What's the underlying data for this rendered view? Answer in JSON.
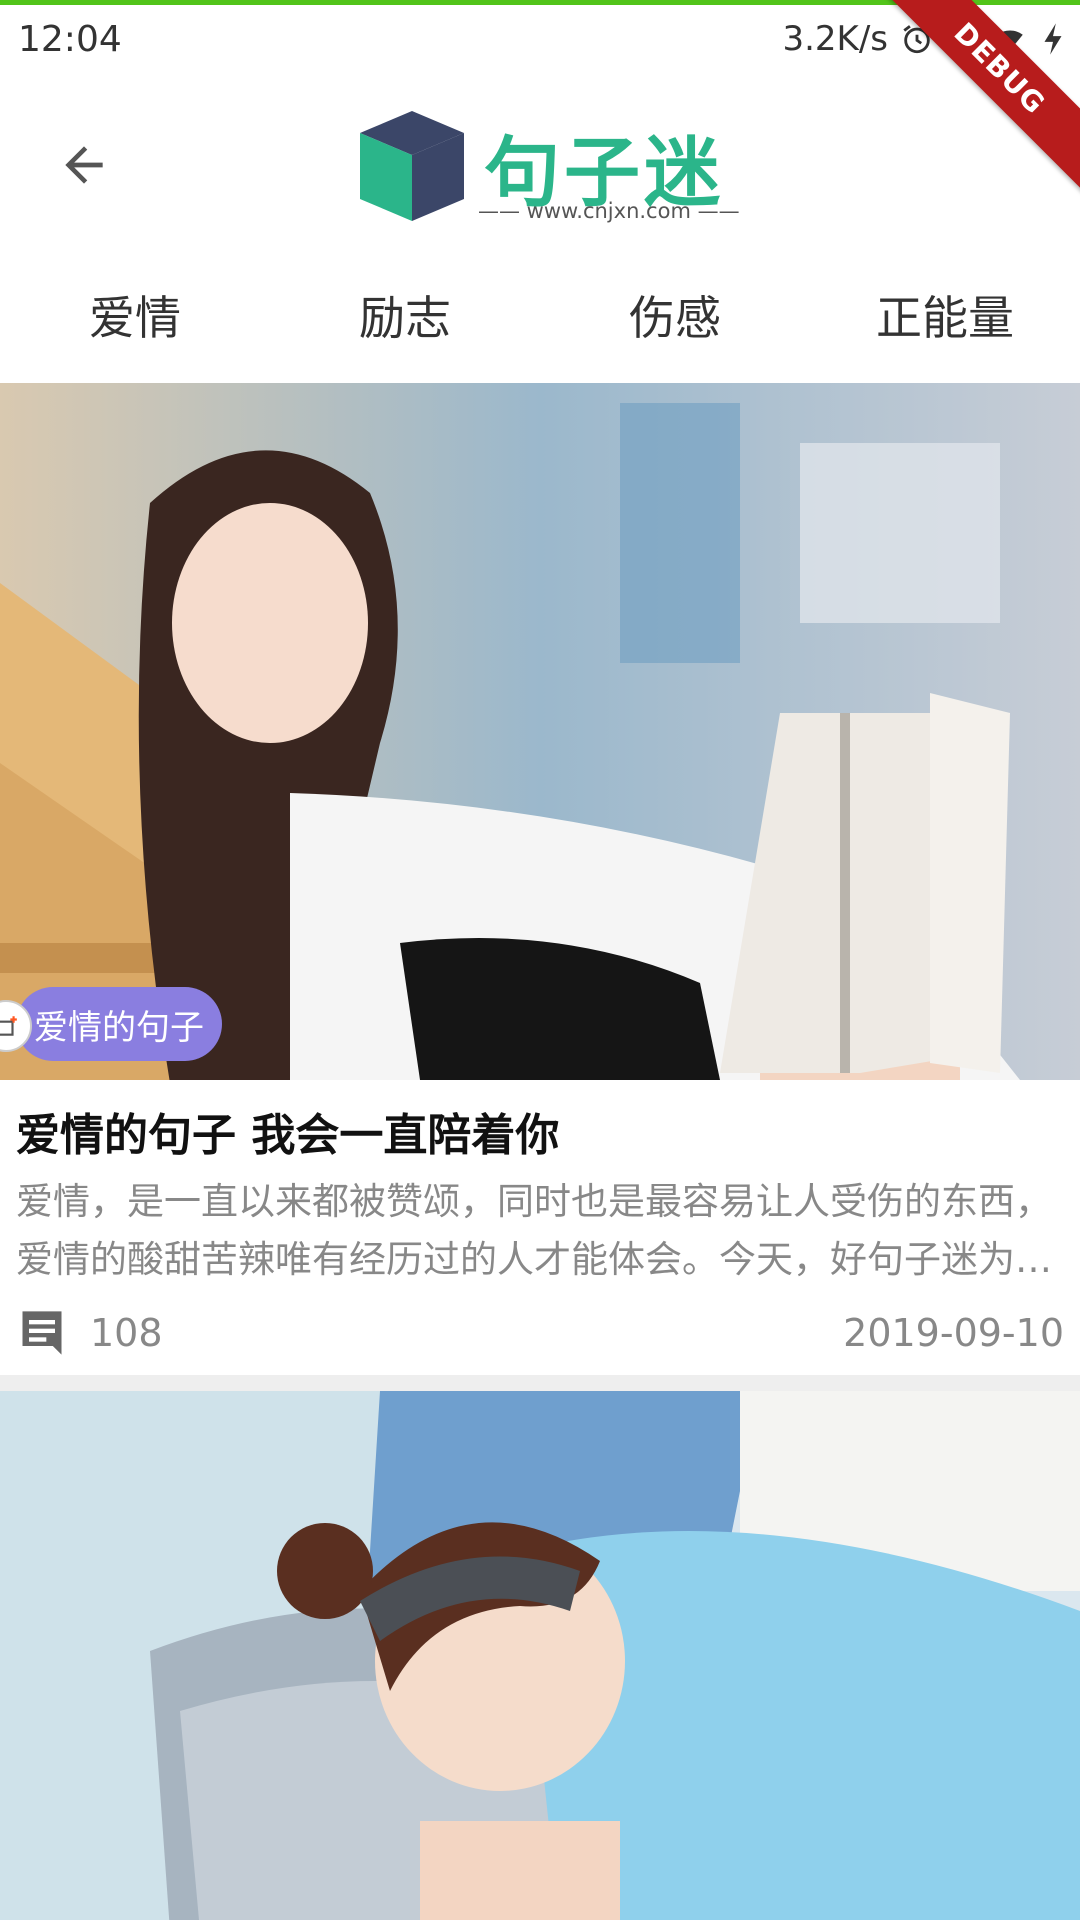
{
  "status_bar": {
    "time": "12:04",
    "network_speed": "3.2K/s",
    "icons": [
      "alarm-icon",
      "signal-icon",
      "wifi-icon",
      "charging-icon"
    ]
  },
  "debug_banner": "DEBUG",
  "app_bar": {
    "back_icon": "arrow-back-icon",
    "logo": {
      "title": "句子迷",
      "url": "—— www.cnjxn.com ——"
    }
  },
  "tabs": [
    {
      "label": "爱情"
    },
    {
      "label": "励志"
    },
    {
      "label": "伤感"
    },
    {
      "label": "正能量"
    }
  ],
  "articles": [
    {
      "tag": "爱情的句子",
      "title": "爱情的句子 我会一直陪着你",
      "summary": "爱情，是一直以来都被赞颂，同时也是最容易让人受伤的东西，爱情的酸甜苦辣唯有经历过的人才能体会。今天，好句子迷为大家带来爱情的句子。",
      "comment_icon": "comment-icon",
      "comments": "108",
      "date": "2019-09-10"
    }
  ],
  "colors": {
    "accent_green": "#2bb58a",
    "badge_purple": "#8a7ee0",
    "debug_red": "#b71c1c",
    "top_line": "#52c41a"
  }
}
